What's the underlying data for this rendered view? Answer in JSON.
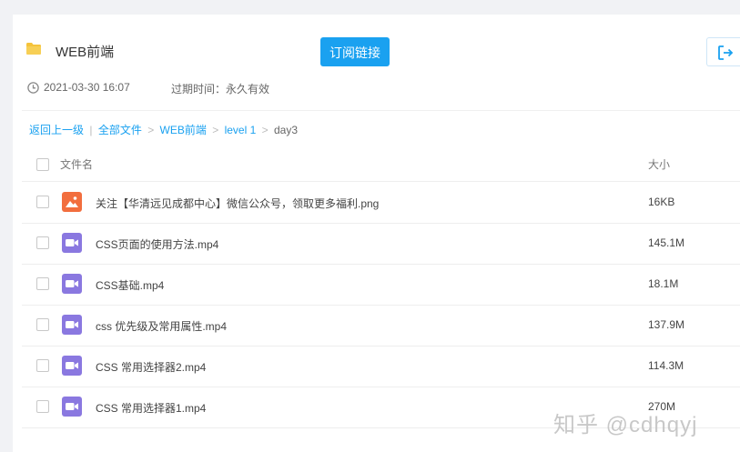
{
  "header": {
    "folder_title": "WEB前端",
    "subscribe_label": "订阅链接",
    "date": "2021-03-30 16:07",
    "expire": "过期时间：永久有效"
  },
  "breadcrumb": {
    "back": "返回上一级",
    "divider": "|",
    "all_files": "全部文件",
    "sep": ">",
    "items": [
      "WEB前端",
      "level 1"
    ],
    "current": "day3"
  },
  "table": {
    "col_name": "文件名",
    "col_size": "大小",
    "rows": [
      {
        "name": "关注【华清远见成都中心】微信公众号，领取更多福利.png",
        "size": "16KB",
        "icon": "image-icon"
      },
      {
        "name": "CSS页面的使用方法.mp4",
        "size": "145.1M",
        "icon": "video-icon"
      },
      {
        "name": "CSS基础.mp4",
        "size": "18.1M",
        "icon": "video-icon"
      },
      {
        "name": "css 优先级及常用属性.mp4",
        "size": "137.9M",
        "icon": "video-icon"
      },
      {
        "name": "CSS 常用选择器2.mp4",
        "size": "114.3M",
        "icon": "video-icon"
      },
      {
        "name": "CSS 常用选择器1.mp4",
        "size": "270M",
        "icon": "video-icon"
      }
    ]
  },
  "watermark": "知乎 @cdhqyj",
  "colors": {
    "accent": "#1aa1f0",
    "image_icon": "#f26e3e",
    "video_icon": "#8a78e0",
    "folder": "#f5c33b"
  }
}
